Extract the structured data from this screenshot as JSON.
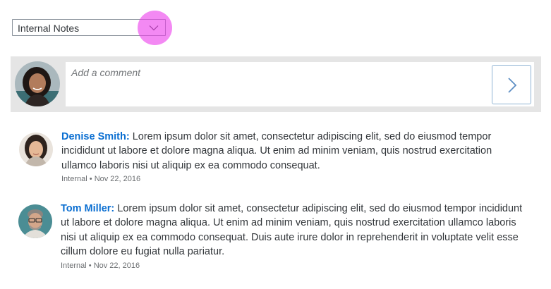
{
  "filter": {
    "selected": "Internal Notes"
  },
  "composer": {
    "placeholder": "Add a comment",
    "value": ""
  },
  "feed": [
    {
      "author": "Denise Smith:",
      "text": "Lorem ipsum dolor sit amet, consectetur adipiscing elit, sed do eiusmod tempor incididunt ut labore et dolore magna aliqua. Ut enim ad minim veniam, quis nostrud exercitation ullamco laboris nisi ut aliquip ex ea commodo consequat.",
      "visibility": "Internal",
      "separator": "•",
      "date": "Nov 22, 2016"
    },
    {
      "author": "Tom Miller:",
      "text": "Lorem ipsum dolor sit amet, consectetur adipiscing elit, sed do eiusmod tempor incididunt ut labore et dolore magna aliqua. Ut enim ad minim veniam, quis nostrud exercitation ullamco laboris nisi ut aliquip ex ea commodo consequat. Duis aute irure dolor in reprehenderit in voluptate velit esse cillum dolore eu fugiat nulla pariatur.",
      "visibility": "Internal",
      "separator": "•",
      "date": "Nov 22, 2016"
    }
  ],
  "colors": {
    "accent": "#0a6ed1",
    "focus_highlight": "#ec40ec",
    "composer_background": "#e5e5e5",
    "border": "#89919a",
    "text": "#32363a"
  },
  "icons": {
    "dropdown": "chevron-down-icon",
    "post": "chevron-right-icon"
  }
}
